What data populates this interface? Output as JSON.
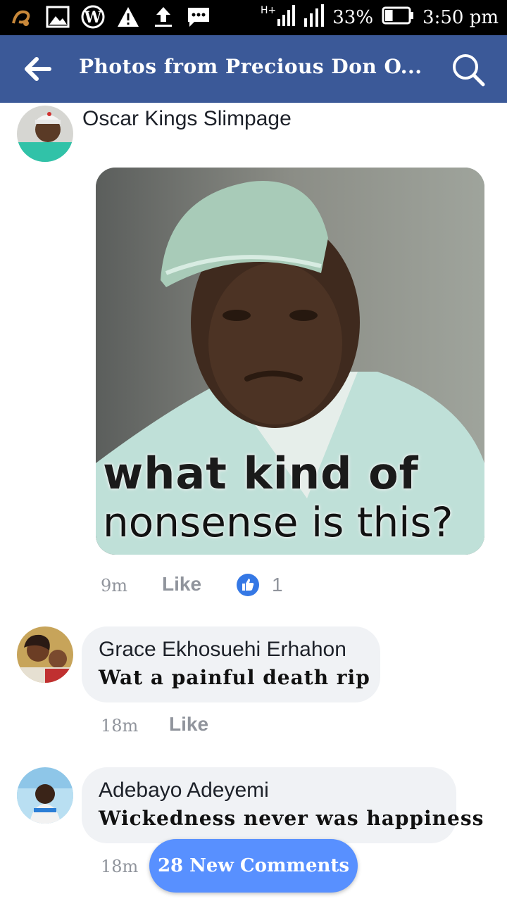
{
  "status_bar": {
    "network_label": "H+",
    "battery_percent": "33%",
    "time": "3:50 pm",
    "battery_level": 0.33,
    "icons": [
      "uc-browser-icon",
      "gallery-icon",
      "wordpress-icon",
      "warning-icon",
      "upload-icon",
      "message-icon",
      "signal-icon",
      "battery-icon"
    ]
  },
  "app_bar": {
    "title": "Photos from Precious Don O...",
    "accent": "#3b5998",
    "icons": [
      "back-arrow-icon",
      "search-icon"
    ]
  },
  "post": {
    "author": "Oscar Kings Slimpage",
    "photo_caption_line1": "what kind of",
    "photo_caption_line2": "nonsense is this?",
    "time": "9m",
    "like_label": "Like",
    "reaction_count": "1"
  },
  "comments": [
    {
      "name": "Grace Ekhosuehi Erhahon",
      "text": "Wat a painful death rip",
      "time": "18m",
      "like_label": "Like"
    },
    {
      "name": "Adebayo Adeyemi",
      "text": "Wickedness never was happiness",
      "time": "18m"
    }
  ],
  "new_comments_button": {
    "label": "28 New Comments",
    "color": "#5890ff"
  }
}
